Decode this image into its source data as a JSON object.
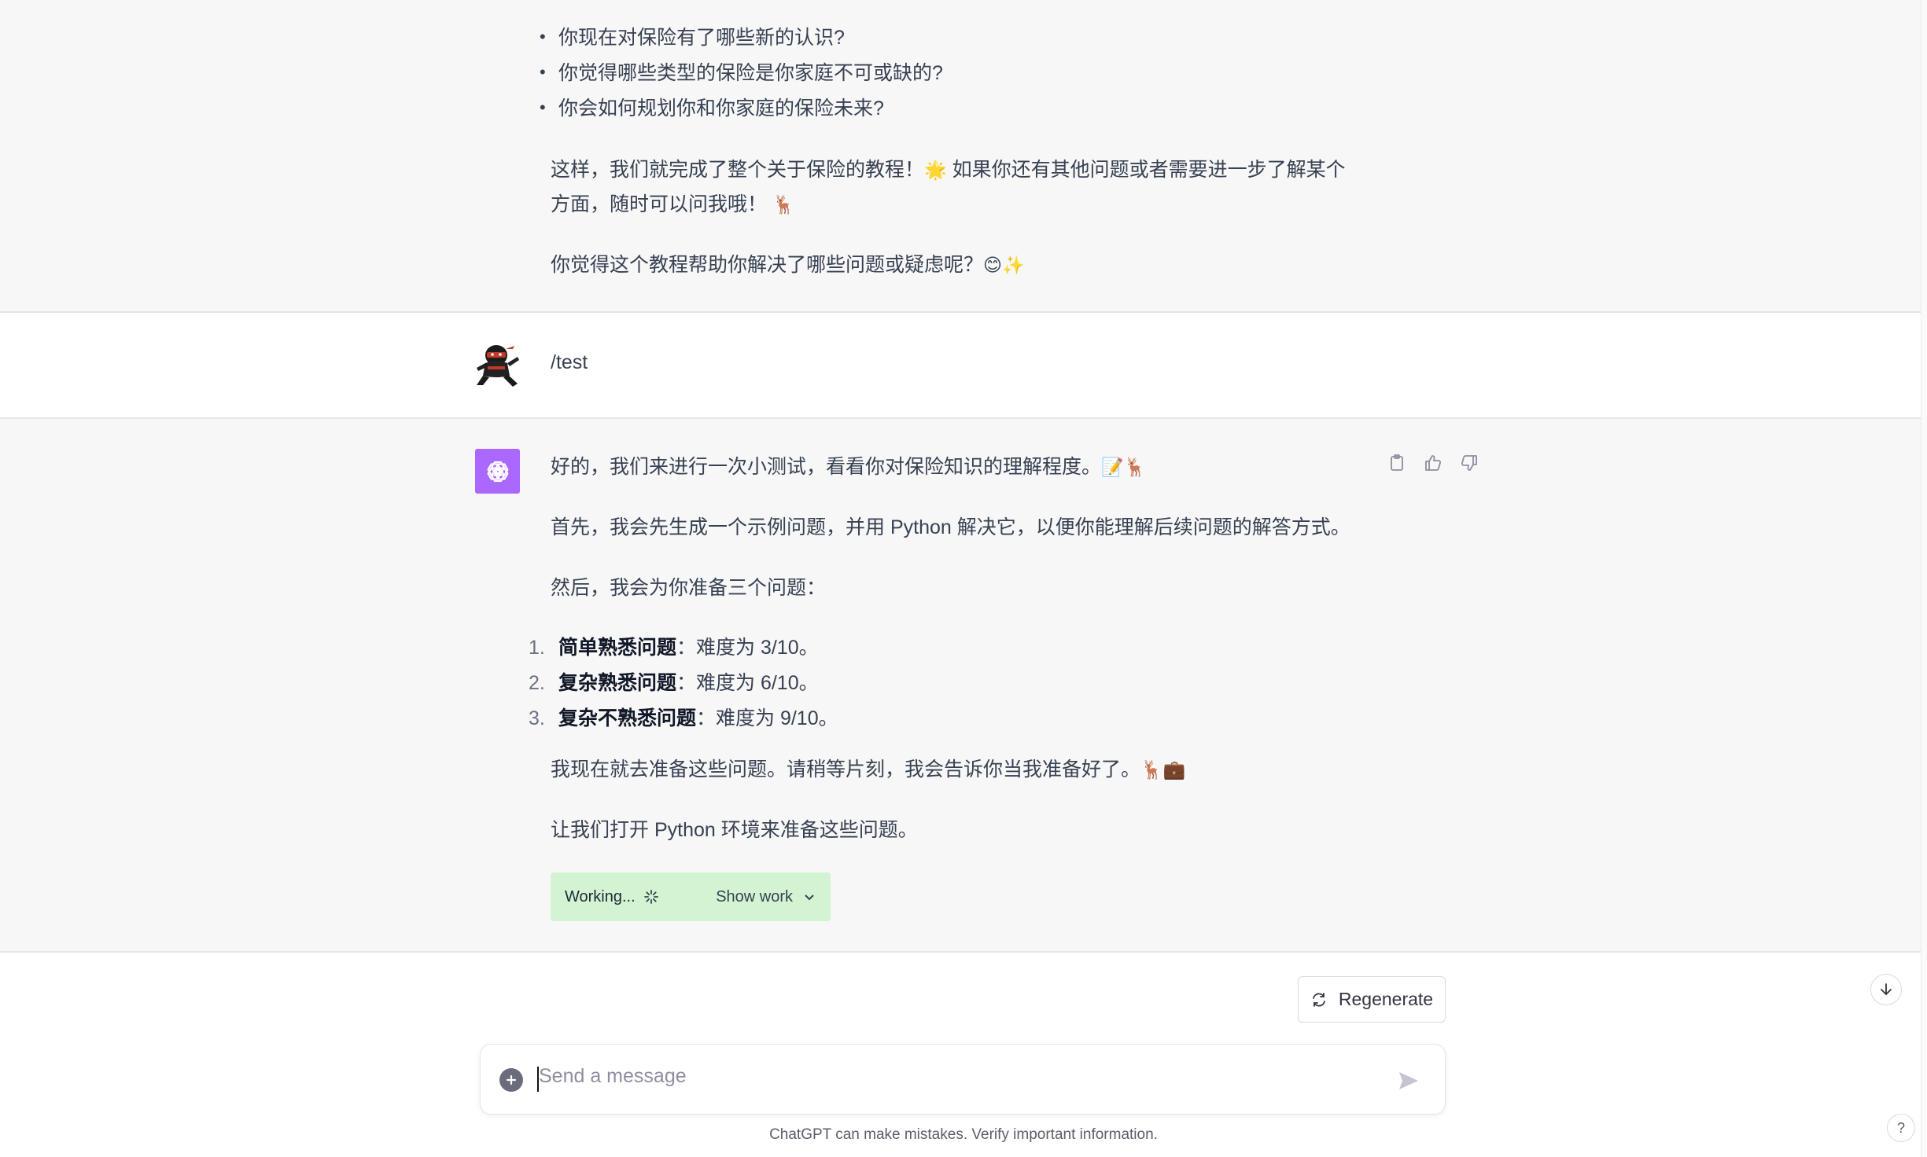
{
  "previous_message": {
    "bullets": [
      "你现在对保险有了哪些新的认识?",
      "你觉得哪些类型的保险是你家庭不可或缺的?",
      "你会如何规划你和你家庭的保险未来?"
    ],
    "para1_line1": "这样，我们就完成了整个关于保险的教程！",
    "para1_emoji1": "🌟",
    "para1_line1b": " 如果你还有其他问题或者需要进一步了解某个",
    "para1_line2": "方面，随时可以问我哦！",
    "para1_emoji2": "🦌",
    "para2": "你觉得这个教程帮助你解决了哪些问题或疑虑呢？",
    "para2_emoji": "😊✨"
  },
  "user_message": {
    "text": "/test",
    "avatar_icon": "ninja-avatar"
  },
  "assistant_message": {
    "intro": "好的，我们来进行一次小测试，看看你对保险知识的理解程度。",
    "intro_emoji": "📝🦌",
    "para1": "首先，我会先生成一个示例问题，并用 Python 解决它，以便你能理解后续问题的解答方式。",
    "para2": "然后，我会为你准备三个问题：",
    "list": [
      {
        "num": "1.",
        "bold": "简单熟悉问题",
        "rest": "：难度为 3/10。"
      },
      {
        "num": "2.",
        "bold": "复杂熟悉问题",
        "rest": "：难度为 6/10。"
      },
      {
        "num": "3.",
        "bold": "复杂不熟悉问题",
        "rest": "：难度为 9/10。"
      }
    ],
    "para3": "我现在就去准备这些问题。请稍等片刻，我会告诉你当我准备好了。",
    "para3_emoji": "🦌💼",
    "para4": "让我们打开 Python 环境来准备这些问题。",
    "working_label": "Working...",
    "show_work_label": "Show work",
    "action_icons": [
      "clipboard-icon",
      "thumbs-up-icon",
      "thumbs-down-icon"
    ]
  },
  "controls": {
    "regenerate_label": "Regenerate",
    "composer_placeholder": "Send a message",
    "disclaimer": "ChatGPT can make mistakes. Verify important information.",
    "help_label": "?"
  },
  "colors": {
    "gpt_avatar_bg": "#ab68ff",
    "working_bg": "#d2f4d3",
    "gray_block_bg": "#f7f7f8"
  }
}
